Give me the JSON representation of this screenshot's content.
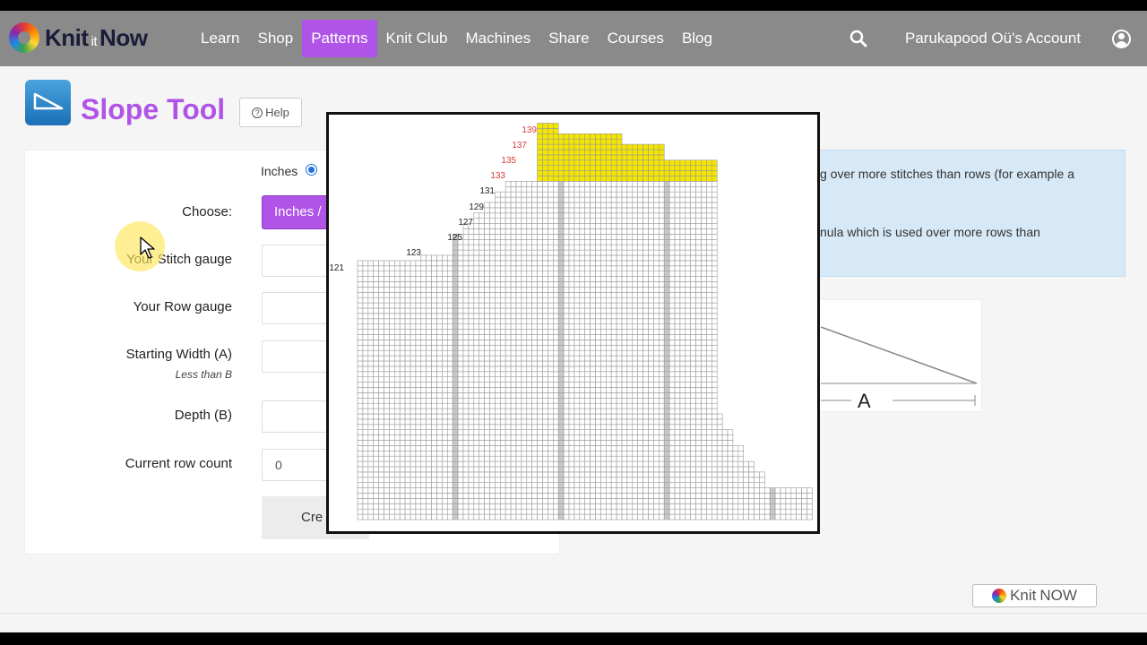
{
  "nav": {
    "logo_main": "Knit",
    "logo_it": "it",
    "logo_now": "Now",
    "items": [
      {
        "label": "Learn",
        "active": false
      },
      {
        "label": "Shop",
        "active": false
      },
      {
        "label": "Patterns",
        "active": true
      },
      {
        "label": "Knit Club",
        "active": false
      },
      {
        "label": "Machines",
        "active": false
      },
      {
        "label": "Share",
        "active": false
      },
      {
        "label": "Courses",
        "active": false
      },
      {
        "label": "Blog",
        "active": false
      }
    ],
    "search_icon": "search-icon",
    "account_label": "Parukapood Oü's Account",
    "user_icon": "user-icon"
  },
  "page": {
    "title": "Slope Tool",
    "help_label": "Help"
  },
  "form": {
    "units_label": "Inches",
    "choose_label": "Choose:",
    "choose_button": "Inches /",
    "stitch_gauge_label": "Your Stitch gauge",
    "row_gauge_label": "Your Row gauge",
    "starting_width_label": "Starting Width (A)",
    "starting_width_hint": "Less than B",
    "depth_label": "Depth (B)",
    "current_row_label": "Current row count",
    "current_row_value": "0",
    "create_button": "Cre"
  },
  "info": {
    "line1": "g over more stitches than rows (for example a",
    "line2": "nula which is used over more rows than"
  },
  "diagram": {
    "width_label": "A"
  },
  "chart": {
    "row_labels_red": [
      "139",
      "137",
      "135",
      "133"
    ],
    "row_labels_black": [
      "131",
      "129",
      "127",
      "125",
      "123",
      "121"
    ],
    "highlight_color": "#f5e600",
    "grid_color": "#9a9a9a",
    "marker_column_color": "#c8c8c8"
  },
  "footer": {
    "badge_text_a": "Knit",
    "badge_text_b": "NOW"
  }
}
